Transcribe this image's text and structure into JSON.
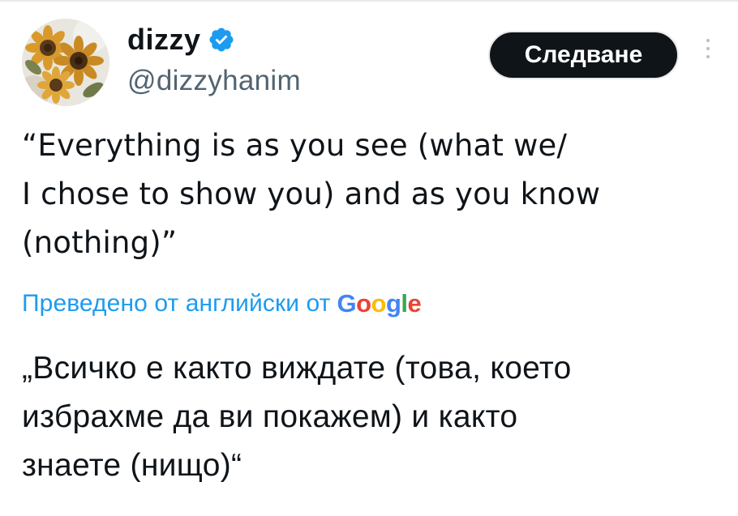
{
  "author": {
    "display_name": "dizzy",
    "handle": "@dizzyhanim",
    "verified_icon": "verified-badge-icon",
    "avatar_icon": "sunflower-avatar"
  },
  "actions": {
    "follow_label": "Следване",
    "more_icon": "more-vertical-icon"
  },
  "tweet": {
    "original_text": "“Everything is as you see (what we/\nI chose to show you) and as you know\n(nothing)”",
    "translation_attribution": "Преведено от английски от",
    "translation_provider": "Google",
    "translated_text": "„Всичко е както виждате (това, което\nизбрахме да ви покажем) и както\nзнаете (нищо)“"
  },
  "colors": {
    "link_blue": "#1d9bf0",
    "verified_blue": "#1d9bf0",
    "handle_gray": "#536471",
    "button_bg": "#0f1419",
    "text_primary": "#0f1419"
  }
}
